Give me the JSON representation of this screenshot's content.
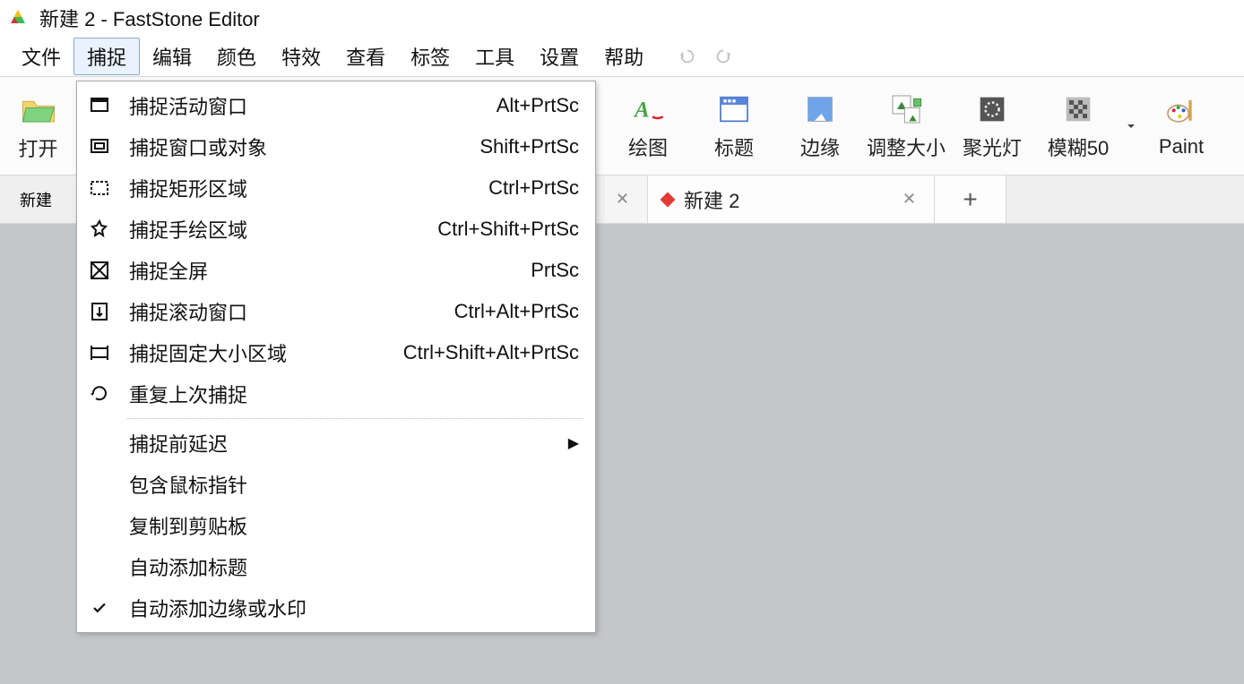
{
  "window": {
    "title": "新建 2 - FastStone Editor"
  },
  "menubar": {
    "items": [
      "文件",
      "捕捉",
      "编辑",
      "颜色",
      "特效",
      "查看",
      "标签",
      "工具",
      "设置",
      "帮助"
    ],
    "active_index": 1
  },
  "toolbar": {
    "open": "打开",
    "buttons": [
      {
        "key": "draw",
        "label": "绘图"
      },
      {
        "key": "title",
        "label": "标题"
      },
      {
        "key": "edge",
        "label": "边缘"
      },
      {
        "key": "resize",
        "label": "调整大小"
      },
      {
        "key": "spot",
        "label": "聚光灯"
      },
      {
        "key": "blur",
        "label": "模糊50"
      },
      {
        "key": "paint",
        "label": "Paint"
      }
    ]
  },
  "tabs": {
    "visible_partial_label": "新建",
    "active": {
      "label": "新建 2"
    }
  },
  "dropdown": {
    "items": [
      {
        "icon": "window",
        "label": "捕捉活动窗口",
        "shortcut": "Alt+PrtSc"
      },
      {
        "icon": "obj",
        "label": "捕捉窗口或对象",
        "shortcut": "Shift+PrtSc"
      },
      {
        "icon": "rect",
        "label": "捕捉矩形区域",
        "shortcut": "Ctrl+PrtSc"
      },
      {
        "icon": "freehand",
        "label": "捕捉手绘区域",
        "shortcut": "Ctrl+Shift+PrtSc"
      },
      {
        "icon": "fullscreen",
        "label": "捕捉全屏",
        "shortcut": "PrtSc"
      },
      {
        "icon": "scroll",
        "label": "捕捉滚动窗口",
        "shortcut": "Ctrl+Alt+PrtSc"
      },
      {
        "icon": "fixed",
        "label": "捕捉固定大小区域",
        "shortcut": "Ctrl+Shift+Alt+PrtSc"
      },
      {
        "icon": "repeat",
        "label": "重复上次捕捉",
        "shortcut": ""
      },
      {
        "sep": true
      },
      {
        "icon": "",
        "label": "捕捉前延迟",
        "submenu": true
      },
      {
        "icon": "",
        "label": "包含鼠标指针",
        "shortcut": ""
      },
      {
        "icon": "",
        "label": "复制到剪贴板",
        "shortcut": ""
      },
      {
        "icon": "",
        "label": "自动添加标题",
        "shortcut": ""
      },
      {
        "icon": "check",
        "label": "自动添加边缘或水印",
        "shortcut": ""
      }
    ]
  }
}
